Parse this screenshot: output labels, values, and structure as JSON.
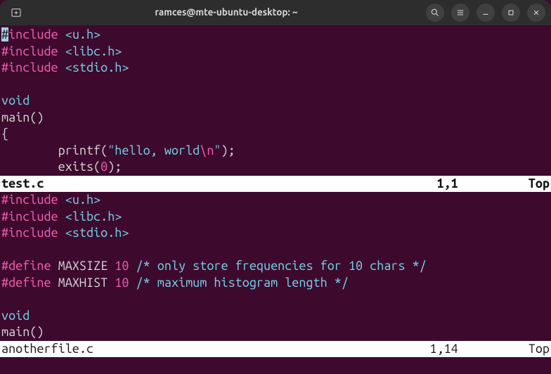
{
  "titlebar": {
    "title": "ramces@mte-ubuntu-desktop: ~"
  },
  "pane1": {
    "lines": {
      "l1": {
        "inc_hash": "#",
        "inc_rest": "include ",
        "hdr": "<u.h>"
      },
      "l2": {
        "full_inc": "#include ",
        "hdr": "<libc.h>"
      },
      "l3": {
        "full_inc": "#include ",
        "hdr": "<stdio.h>"
      },
      "l4": "",
      "l5": "void",
      "l6": "main()",
      "l7": "{",
      "l8": {
        "indent": "        printf(",
        "str1": "\"hello, world",
        "esc": "\\n",
        "str2": "\"",
        "tail": ");"
      },
      "l9": {
        "indent": "        exits(",
        "num": "0",
        "tail": ");"
      }
    },
    "status": {
      "filename": "test.c",
      "position": "1,1",
      "scroll": "Top"
    }
  },
  "pane2": {
    "lines": {
      "l1": {
        "full_inc": "#include ",
        "hdr": "<u.h>"
      },
      "l2": {
        "full_inc": "#include ",
        "hdr": "<libc.h>"
      },
      "l3": {
        "full_inc": "#include ",
        "hdr": "<stdio.h>"
      },
      "l4": "",
      "l5": {
        "def": "#define ",
        "name": "MAXSIZE ",
        "val": "10",
        "sp": " ",
        "cmt": "/* only store frequencies for 10 chars */"
      },
      "l6": {
        "def": "#define ",
        "name": "MAXHIST ",
        "val": "10",
        "sp": " ",
        "cmt": "/* maximum histogram length */"
      },
      "l7": "",
      "l8": "void",
      "l9": "main()"
    },
    "status": {
      "filename": "anotherfile.c",
      "position": "1,14",
      "scroll": "Top"
    }
  }
}
